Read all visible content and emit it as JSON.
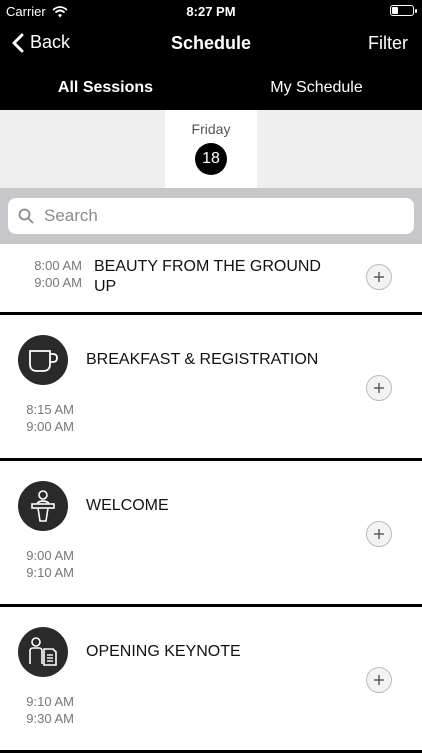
{
  "status_bar": {
    "carrier": "Carrier",
    "time": "8:27 PM"
  },
  "nav": {
    "back_label": "Back",
    "title": "Schedule",
    "filter_label": "Filter"
  },
  "tabs": [
    {
      "label": "All Sessions",
      "active": true
    },
    {
      "label": "My Schedule",
      "active": false
    }
  ],
  "date": {
    "day": "Friday",
    "number": "18"
  },
  "search": {
    "placeholder": "Search"
  },
  "sessions": [
    {
      "start": "8:00 AM",
      "end": "9:00 AM",
      "title": "BEAUTY FROM THE GROUND UP",
      "icon": "none"
    },
    {
      "start": "8:15 AM",
      "end": "9:00 AM",
      "title": "BREAKFAST & REGISTRATION",
      "icon": "coffee-cup-icon"
    },
    {
      "start": "9:00 AM",
      "end": "9:10 AM",
      "title": "WELCOME",
      "icon": "speaker-podium-icon"
    },
    {
      "start": "9:10 AM",
      "end": "9:30 AM",
      "title": "OPENING KEYNOTE",
      "icon": "presenter-document-icon"
    }
  ],
  "colors": {
    "header": "#000000",
    "date_bar": "#efefef",
    "search_bar": "#c8c8cc",
    "badge": "#2a2a2a"
  }
}
